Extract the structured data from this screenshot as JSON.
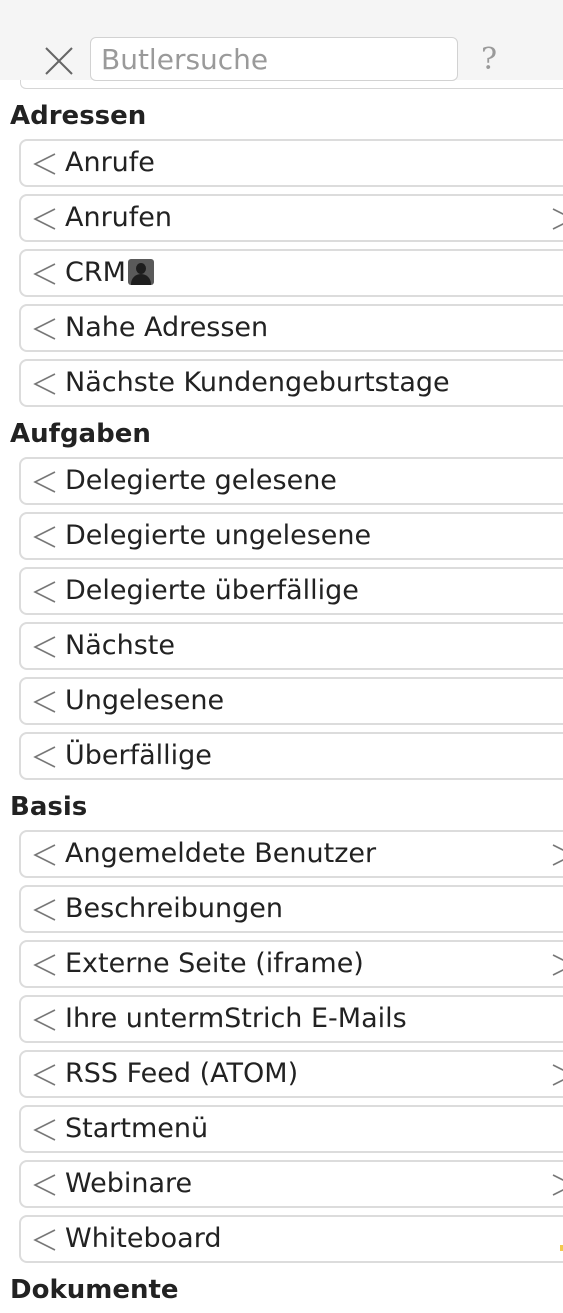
{
  "search": {
    "placeholder": "Butlersuche",
    "value": ""
  },
  "icons": {
    "close": "close-icon",
    "help": "help-icon",
    "collapse": "chevron-left-icon",
    "expand": "chevron-right-icon",
    "avatar": "user-avatar-icon"
  },
  "help_glyph": "?",
  "sections": {
    "adressen": {
      "title": "Adressen",
      "items": [
        {
          "label": "Anrufe",
          "has_submenu": false
        },
        {
          "label": "Anrufen",
          "has_submenu": true
        },
        {
          "label": "CRM",
          "has_submenu": false,
          "has_avatar": true
        },
        {
          "label": "Nahe Adressen",
          "has_submenu": false
        },
        {
          "label": "Nächste Kundengeburtstage",
          "has_submenu": false
        }
      ]
    },
    "aufgaben": {
      "title": "Aufgaben",
      "items": [
        {
          "label": "Delegierte gelesene",
          "has_submenu": false
        },
        {
          "label": "Delegierte ungelesene",
          "has_submenu": false
        },
        {
          "label": "Delegierte überfällige",
          "has_submenu": false
        },
        {
          "label": "Nächste",
          "has_submenu": false
        },
        {
          "label": "Ungelesene",
          "has_submenu": false
        },
        {
          "label": "Überfällige",
          "has_submenu": false
        }
      ]
    },
    "basis": {
      "title": "Basis",
      "items": [
        {
          "label": "Angemeldete Benutzer",
          "has_submenu": true
        },
        {
          "label": "Beschreibungen",
          "has_submenu": false
        },
        {
          "label": "Externe Seite (iframe)",
          "has_submenu": true
        },
        {
          "label": "Ihre untermStrich E-Mails",
          "has_submenu": false
        },
        {
          "label": "RSS Feed (ATOM)",
          "has_submenu": true
        },
        {
          "label": "Startmenü",
          "has_submenu": false
        },
        {
          "label": "Webinare",
          "has_submenu": true
        },
        {
          "label": "Whiteboard",
          "has_submenu": false
        }
      ]
    },
    "dokumente": {
      "title": "Dokumente"
    }
  }
}
